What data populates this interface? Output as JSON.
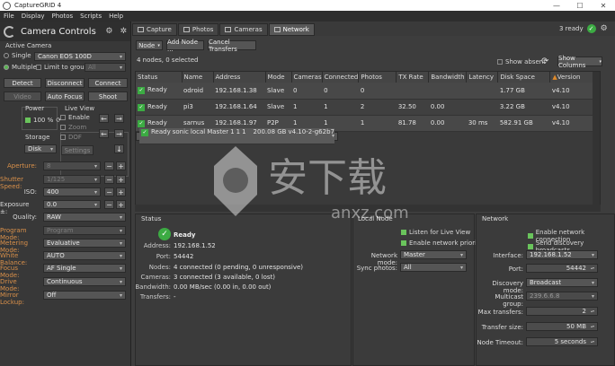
{
  "window": {
    "title": "CaptureGRID 4",
    "controls": [
      "—",
      "☐",
      "✕"
    ]
  },
  "menu": [
    "File",
    "Display",
    "Photos",
    "Scripts",
    "Help"
  ],
  "camera_controls": {
    "title": "Camera Controls",
    "active_camera_label": "Active Camera",
    "single_label": "Single",
    "single_value": "Canon EOS 100D",
    "multiple_label": "Multiple",
    "limit_label": "Limit to group:",
    "limit_value": "All",
    "btn_detect": "Detect",
    "btn_disconnect": "Disconnect",
    "btn_connect": "Connect",
    "btn_video": "Video",
    "btn_autofocus": "Auto Focus",
    "btn_shoot": "Shoot",
    "power_label": "Power",
    "power_value": "100 %",
    "liveview_label": "Live View",
    "enable_label": "Enable",
    "zoom_label": "Zoom",
    "dof_label": "DOF",
    "settings_label": "Settings",
    "storage_label": "Storage",
    "storage_value": "Disk",
    "aperture_label": "Aperture:",
    "aperture_value": "8",
    "shutter_label": "Shutter Speed:",
    "shutter_value": "1/125",
    "iso_label": "ISO:",
    "iso_value": "400",
    "exposure_label": "Exposure ±:",
    "exposure_value": "0.0",
    "quality_label": "Quality:",
    "quality_value": "RAW",
    "program_label": "Program Mode:",
    "program_value": "Program",
    "metering_label": "Metering Mode:",
    "metering_value": "Evaluative",
    "wb_label": "White Balance:",
    "wb_value": "AUTO",
    "focus_label": "Focus Mode:",
    "focus_value": "AF Single",
    "drive_label": "Drive Mode:",
    "drive_value": "Continuous",
    "mirror_label": "Mirror Lockup:",
    "mirror_value": "Off"
  },
  "tabs": [
    "Capture",
    "Photos",
    "Cameras",
    "Network"
  ],
  "ready_status": "3 ready",
  "toolbar": {
    "node": "Node",
    "add_node": "Add Node ...",
    "cancel": "Cancel Transfers",
    "show_absent": "Show absent",
    "show_columns": "Show Columns"
  },
  "nodes_info": "4 nodes, 0 selected",
  "table": {
    "headers": [
      "Status",
      "Name",
      "Address",
      "Mode",
      "Cameras",
      "Connected",
      "Photos",
      "TX Rate",
      "Bandwidth",
      "Latency",
      "Disk Space",
      "Version"
    ],
    "rows": [
      [
        "Ready",
        "odroid",
        "192.168.1.38",
        "Slave",
        "0",
        "0",
        "0",
        "",
        "",
        "",
        "1.77 GB",
        "v4.10"
      ],
      [
        "Ready",
        "pi3",
        "192.168.1.64",
        "Slave",
        "1",
        "1",
        "2",
        "32.50",
        "0.00",
        "",
        "3.22 GB",
        "v4.10"
      ],
      [
        "Ready",
        "sarnus",
        "192.168.1.97",
        "P2P",
        "1",
        "1",
        "1",
        "81.78",
        "0.00",
        "30 ms",
        "582.91 GB",
        "v4.10"
      ],
      [
        "Ready",
        "sonic",
        "local",
        "Master",
        "1",
        "1",
        "1",
        "",
        "",
        "",
        "200.08 GB",
        "v4.10-2-g62b7"
      ]
    ]
  },
  "status_panel": {
    "title": "Status",
    "state": "Ready",
    "fields": [
      {
        "k": "Address:",
        "v": "192.168.1.52"
      },
      {
        "k": "Port:",
        "v": "54442"
      },
      {
        "k": "Nodes:",
        "v": "4 connected (0 pending, 0 unresponsive)"
      },
      {
        "k": "Cameras:",
        "v": "3 connected (3 available, 0 lost)"
      },
      {
        "k": "Bandwidth:",
        "v": "0.00 MB/sec (0.00 in, 0.00 out)"
      },
      {
        "k": "Transfers:",
        "v": "-"
      }
    ]
  },
  "local_node": {
    "title": "Local Node",
    "listen": "Listen for Live View",
    "priority": "Enable network priority",
    "mode_label": "Network mode:",
    "mode_value": "Master",
    "sync_label": "Sync photos:",
    "sync_value": "All"
  },
  "network": {
    "title": "Network",
    "enable_conn": "Enable network connection",
    "send_disc": "Send discovery broadcasts",
    "iface_label": "Interface:",
    "iface_value": "192.168.1.52",
    "port_label": "Port:",
    "port_value": "54442",
    "disc_label": "Discovery mode:",
    "disc_value": "Broadcast",
    "mcast_label": "Multicast group:",
    "mcast_value": "239.6.6.8",
    "max_label": "Max transfers:",
    "max_value": "2",
    "tsize_label": "Transfer size:",
    "tsize_value": "50 MB",
    "timeout_label": "Node Timeout:",
    "timeout_value": "5 seconds"
  },
  "watermark": {
    "cn": "安下载",
    "en": "anxz.com"
  }
}
